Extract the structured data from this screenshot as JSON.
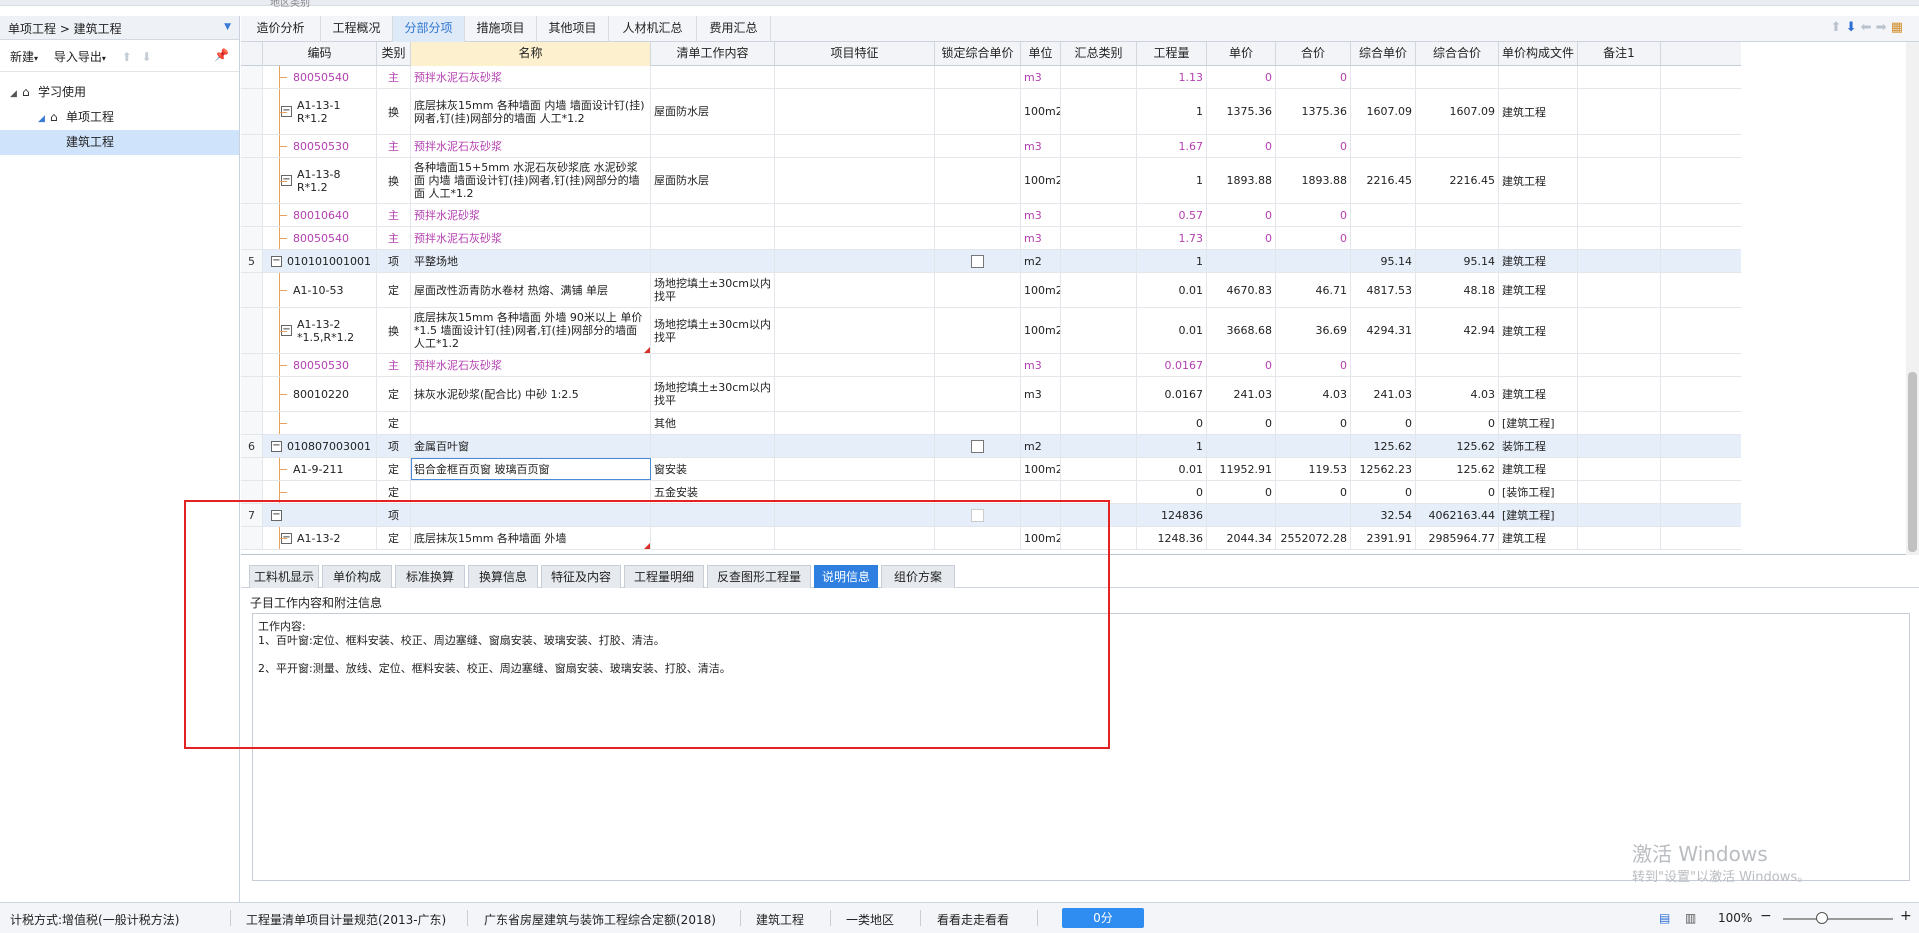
{
  "top_strip_text": "地区类别",
  "breadcrumb": "单项工程 > 建筑工程",
  "left_toolbar": {
    "new_label": "新建",
    "import_export_label": "导入导出"
  },
  "tree": [
    {
      "label": "学习使用",
      "level": 0,
      "icon": "house-icon"
    },
    {
      "label": "单项工程",
      "level": 1,
      "icon": "house-icon"
    },
    {
      "label": "建筑工程",
      "level": 2,
      "icon": "",
      "selected": true
    }
  ],
  "tabs": [
    "造价分析",
    "工程概况",
    "分部分项",
    "措施项目",
    "其他项目",
    "人材机汇总",
    "费用汇总"
  ],
  "active_tab": "分部分项",
  "columns": [
    "编码",
    "类别",
    "名称",
    "清单工作内容",
    "项目特征",
    "锁定综合单价",
    "单位",
    "汇总类别",
    "工程量",
    "单价",
    "合价",
    "综合单价",
    "综合合价",
    "单价构成文件",
    "备注1"
  ],
  "rows": [
    {
      "no": "",
      "code": "80050540",
      "type": "主",
      "name": "预拌水泥石灰砂浆",
      "work": "",
      "unit": "m3",
      "qty": "1.13",
      "price": "0",
      "total": "0",
      "cprice": "",
      "ctotal": "",
      "file": "",
      "purple": true
    },
    {
      "no": "",
      "code": "A1-13-1 R*1.2",
      "type": "换",
      "name": "底层抹灰15mm 各种墙面 内墙 墙面设计钉(挂)网者,钉(挂)网部分的墙面 人工*1.2",
      "work": "屋面防水层",
      "unit": "100m2",
      "qty": "1",
      "price": "1375.36",
      "total": "1375.36",
      "cprice": "1607.09",
      "ctotal": "1607.09",
      "file": "建筑工程",
      "collapse": true
    },
    {
      "no": "",
      "code": "80050530",
      "type": "主",
      "name": "预拌水泥石灰砂浆",
      "work": "",
      "unit": "m3",
      "qty": "1.67",
      "price": "0",
      "total": "0",
      "cprice": "",
      "ctotal": "",
      "file": "",
      "purple": true
    },
    {
      "no": "",
      "code": "A1-13-8 R*1.2",
      "type": "换",
      "name": "各种墙面15+5mm 水泥石灰砂浆底 水泥砂浆面 内墙 墙面设计钉(挂)网者,钉(挂)网部分的墙面 人工*1.2",
      "work": "屋面防水层",
      "unit": "100m2",
      "qty": "1",
      "price": "1893.88",
      "total": "1893.88",
      "cprice": "2216.45",
      "ctotal": "2216.45",
      "file": "建筑工程",
      "collapse": true
    },
    {
      "no": "",
      "code": "80010640",
      "type": "主",
      "name": "预拌水泥砂浆",
      "work": "",
      "unit": "m3",
      "qty": "0.57",
      "price": "0",
      "total": "0",
      "cprice": "",
      "ctotal": "",
      "file": "",
      "purple": true
    },
    {
      "no": "",
      "code": "80050540",
      "type": "主",
      "name": "预拌水泥石灰砂浆",
      "work": "",
      "unit": "m3",
      "qty": "1.73",
      "price": "0",
      "total": "0",
      "cprice": "",
      "ctotal": "",
      "file": "",
      "purple": true
    },
    {
      "no": "5",
      "code": "010101001001",
      "type": "项",
      "name": "平整场地",
      "work": "",
      "unit": "m2",
      "qty": "1",
      "price": "",
      "total": "",
      "cprice": "95.14",
      "ctotal": "95.14",
      "file": "建筑工程",
      "clause": true,
      "check": true
    },
    {
      "no": "",
      "code": "A1-10-53",
      "type": "定",
      "name": "屋面改性沥青防水卷材 热熔、满铺 单层",
      "work": "场地挖填土±30cm以内找平",
      "unit": "100m2",
      "qty": "0.01",
      "price": "4670.83",
      "total": "46.71",
      "cprice": "4817.53",
      "ctotal": "48.18",
      "file": "建筑工程"
    },
    {
      "no": "",
      "code": "A1-13-2 *1.5,R*1.2",
      "type": "换",
      "name": "底层抹灰15mm 各种墙面 外墙 90米以上 单价*1.5 墙面设计钉(挂)网者,钉(挂)网部分的墙面 人工*1.2",
      "work": "场地挖填土±30cm以内找平",
      "unit": "100m2",
      "qty": "0.01",
      "price": "3668.68",
      "total": "36.69",
      "cprice": "4294.31",
      "ctotal": "42.94",
      "file": "建筑工程",
      "collapse": true,
      "flag": true
    },
    {
      "no": "",
      "code": "80050530",
      "type": "主",
      "name": "预拌水泥石灰砂浆",
      "work": "",
      "unit": "m3",
      "qty": "0.0167",
      "price": "0",
      "total": "0",
      "cprice": "",
      "ctotal": "",
      "file": "",
      "purple": true
    },
    {
      "no": "",
      "code": "80010220",
      "type": "定",
      "name": "抹灰水泥砂浆(配合比) 中砂 1:2.5",
      "work": "场地挖填土±30cm以内找平",
      "unit": "m3",
      "qty": "0.0167",
      "price": "241.03",
      "total": "4.03",
      "cprice": "241.03",
      "ctotal": "4.03",
      "file": "建筑工程"
    },
    {
      "no": "",
      "code": "",
      "type": "定",
      "name": "",
      "work": "其他",
      "unit": "",
      "qty": "0",
      "price": "0",
      "total": "0",
      "cprice": "0",
      "ctotal": "0",
      "file": "[建筑工程]"
    },
    {
      "no": "6",
      "code": "010807003001",
      "type": "项",
      "name": "金属百叶窗",
      "work": "",
      "unit": "m2",
      "qty": "1",
      "price": "",
      "total": "",
      "cprice": "125.62",
      "ctotal": "125.62",
      "file": "装饰工程",
      "clause": true,
      "check": true
    },
    {
      "no": "",
      "code": "A1-9-211",
      "type": "定",
      "name": "铝合金框百页窗 玻璃百页窗",
      "work": "窗安装",
      "unit": "100m2",
      "qty": "0.01",
      "price": "11952.91",
      "total": "119.53",
      "cprice": "12562.23",
      "ctotal": "125.62",
      "file": "建筑工程",
      "selected": true
    },
    {
      "no": "",
      "code": "",
      "type": "定",
      "name": "",
      "work": "五金安装",
      "unit": "",
      "qty": "0",
      "price": "0",
      "total": "0",
      "cprice": "0",
      "ctotal": "0",
      "file": "[装饰工程]"
    },
    {
      "no": "7",
      "code": "",
      "type": "项",
      "name": "",
      "work": "",
      "unit": "",
      "qty": "124836",
      "price": "",
      "total": "",
      "cprice": "32.54",
      "ctotal": "4062163.44",
      "file": "[建筑工程]",
      "clause": true,
      "check": true,
      "check_dim": true,
      "collapse": true
    },
    {
      "no": "",
      "code": "A1-13-2",
      "type": "定",
      "name": "底层抹灰15mm 各种墙面 外墙",
      "work": "",
      "unit": "100m2",
      "qty": "1248.36",
      "price": "2044.34",
      "total": "2552072.28",
      "cprice": "2391.91",
      "ctotal": "2985964.77",
      "file": "建筑工程",
      "collapse": true,
      "flag": true
    }
  ],
  "sub_tabs": [
    "工料机显示",
    "单价构成",
    "标准换算",
    "换算信息",
    "特征及内容",
    "工程量明细",
    "反查图形工程量",
    "说明信息",
    "组价方案"
  ],
  "active_sub_tab": "说明信息",
  "info": {
    "title": "子目工作内容和附注信息",
    "heading": "工作内容:",
    "line1": "1、百叶窗:定位、框料安装、校正、周边塞缝、窗扇安装、玻璃安装、打胶、清洁。",
    "line2": "2、平开窗:测量、放线、定位、框料安装、校正、周边塞缝、窗扇安装、玻璃安装、打胶、清洁。"
  },
  "watermark": {
    "line1": "激活 Windows",
    "line2": "转到\"设置\"以激活 Windows。"
  },
  "status": {
    "tax": "计税方式:增值税(一般计税方法)",
    "rule": "工程量清单项目计量规范(2013-广东)",
    "quota": "广东省房屋建筑与装饰工程综合定额(2018)",
    "project": "建筑工程",
    "region": "一类地区",
    "watch": "看看走走看看",
    "score": "0分",
    "zoom": "100%"
  },
  "colors": {
    "accent": "#2f7fe0",
    "highlight_box": "#e32222",
    "purple_text": "#b43fb0",
    "clause_row": "#e6eefa"
  }
}
